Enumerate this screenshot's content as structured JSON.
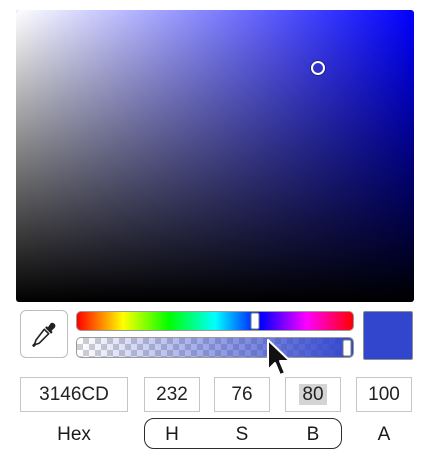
{
  "picker": {
    "hue_color": "#0000ff",
    "selected_color": "#3146CD",
    "hue_position": 0.644,
    "saturation": 0.76,
    "brightness": 0.8,
    "alpha": 1.0
  },
  "icons": {
    "eyedropper": "eyedropper-icon",
    "cursor": "arrow-cursor-icon"
  },
  "fields": {
    "hex": "3146CD",
    "h": "232",
    "s": "76",
    "b": "80",
    "a": "100"
  },
  "labels": {
    "hex": "Hex",
    "h": "H",
    "s": "S",
    "b": "B",
    "a": "A"
  }
}
